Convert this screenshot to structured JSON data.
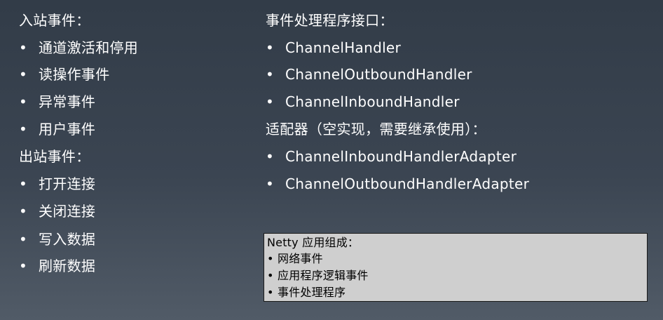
{
  "left": {
    "inbound_heading": "入站事件：",
    "inbound_items": [
      "通道激活和停用",
      "读操作事件",
      "异常事件",
      "用户事件"
    ],
    "outbound_heading": "出站事件：",
    "outbound_items": [
      "打开连接",
      "关闭连接",
      "写入数据",
      "刷新数据"
    ]
  },
  "right": {
    "interfaces_heading": "事件处理程序接口：",
    "interfaces": [
      "ChannelHandler",
      "ChannelOutboundHandler",
      "ChannelInboundHandler"
    ],
    "adapters_heading": "适配器（空实现，需要继承使用）：",
    "adapters": [
      "ChannelInboundHandlerAdapter",
      "ChannelOutboundHandlerAdapter"
    ]
  },
  "box": {
    "title": "Netty 应用组成：",
    "items": [
      "网络事件",
      "应用程序逻辑事件",
      "事件处理程序"
    ]
  },
  "bullet_glyph": "•"
}
